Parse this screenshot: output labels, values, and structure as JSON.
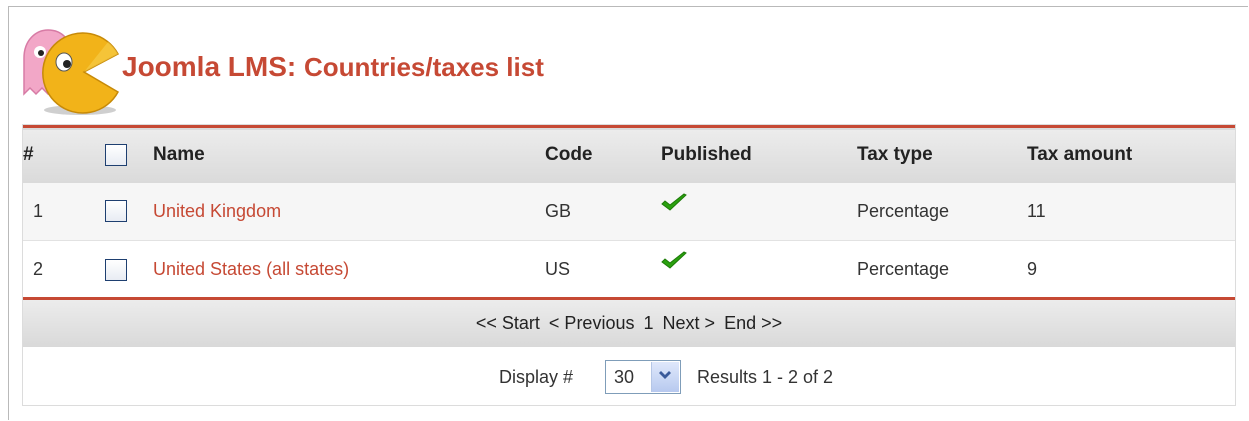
{
  "header": {
    "brand": "Joomla LMS:",
    "subtitle": "Countries/taxes list"
  },
  "table": {
    "columns": {
      "num": "#",
      "name": "Name",
      "code": "Code",
      "published": "Published",
      "tax_type": "Tax type",
      "tax_amount": "Tax amount"
    },
    "rows": [
      {
        "num": "1",
        "name": "United Kingdom",
        "code": "GB",
        "published": true,
        "tax_type": "Percentage",
        "tax_amount": "11"
      },
      {
        "num": "2",
        "name": "United States (all states)",
        "code": "US",
        "published": true,
        "tax_type": "Percentage",
        "tax_amount": "9"
      }
    ]
  },
  "pager": {
    "start": "<< Start",
    "previous": "< Previous",
    "page": "1",
    "next": "Next >",
    "end": "End >>"
  },
  "footer": {
    "display_label": "Display #",
    "display_value": "30",
    "results": "Results 1 - 2 of 2"
  },
  "colors": {
    "accent": "#c64934",
    "check_green": "#2aa10f"
  },
  "icons": {
    "logo": "pacman-ghost-logo",
    "published": "checkmark-icon",
    "dropdown": "chevron-down-icon"
  }
}
